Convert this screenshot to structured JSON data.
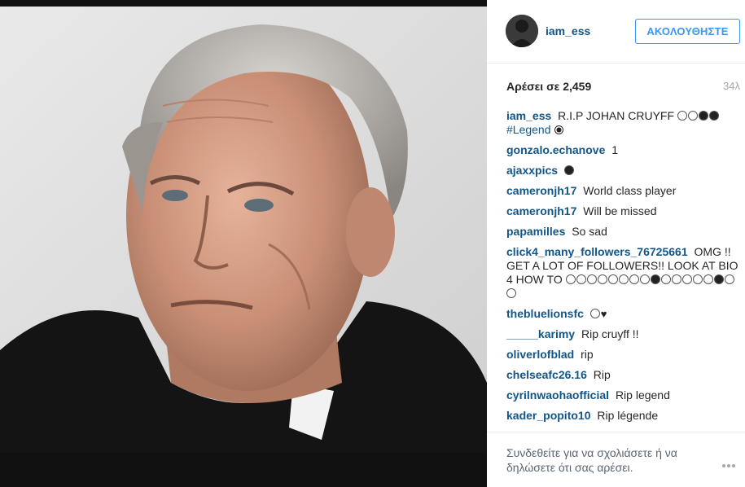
{
  "post": {
    "image_subject": "portrait photo",
    "owner": {
      "username": "iam_ess"
    },
    "follow_button": "ΑΚΟΛΟΥΘΗΣΤΕ",
    "likes": "Αρέσει σε 2,459",
    "time": "34λ",
    "comments": [
      {
        "user": "iam_ess",
        "text": "R.I.P JOHAN CRUYFF",
        "tail": "#Legend",
        "emoji": [
          "sad",
          "sad",
          "hands",
          "hands"
        ],
        "tail_emoji": "ball"
      },
      {
        "user": "gonzalo.echanove",
        "text": "1"
      },
      {
        "user": "ajaxxpics",
        "text": "",
        "emoji": [
          "hands"
        ]
      },
      {
        "user": "cameronjh17",
        "text": "World class player"
      },
      {
        "user": "cameronjh17",
        "text": "Will be missed"
      },
      {
        "user": "papamilles",
        "text": "So sad"
      },
      {
        "user": "click4_many_followers_76725661",
        "text": "OMG !! GET A LOT OF FOLLOWERS!! LOOK AT BIO 4 HOW TO"
      },
      {
        "user": "thebluelionsfc",
        "text": "",
        "emoji": [
          "sad",
          "heart"
        ]
      },
      {
        "user": "_____karimy",
        "text": "Rip cruyff !!"
      },
      {
        "user": "oliverlofblad",
        "text": "rip"
      },
      {
        "user": "chelseafc26.16",
        "text": "Rip"
      },
      {
        "user": "cyrilnwaohaofficial",
        "text": "Rip legend"
      },
      {
        "user": "kader_popito10",
        "text": "Rip légende"
      }
    ],
    "login_prompt": "Συνδεθείτε για να σχολιάσετε ή να δηλώσετε ότι σας αρέσει.",
    "more_icon": "more-options-icon"
  },
  "colors": {
    "link": "#125688",
    "accent": "#3897f0",
    "muted": "#a5a7aa"
  }
}
